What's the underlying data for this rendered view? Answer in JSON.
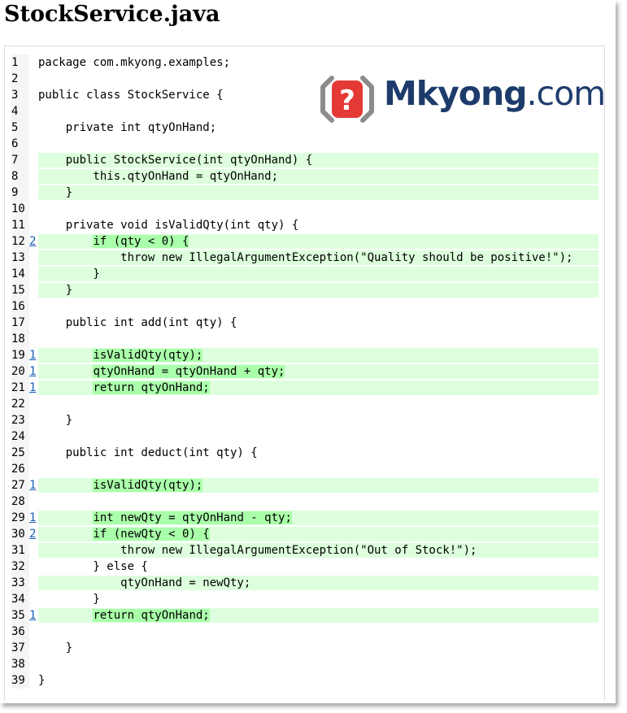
{
  "page": {
    "title": "StockService.java"
  },
  "logo": {
    "brand": "Mkyong",
    "suffix": ".com",
    "mark_glyph": "?"
  },
  "colors": {
    "covered_bg": "#ddffdd",
    "covered_highlight": "#aaffaa",
    "brand": "#1d3c6b",
    "mark_red": "#e53935"
  },
  "code": {
    "lines": [
      {
        "n": "1",
        "hits": "",
        "text": "package com.mkyong.examples;",
        "status": "none"
      },
      {
        "n": "2",
        "hits": "",
        "text": "",
        "status": "none"
      },
      {
        "n": "3",
        "hits": "",
        "text": "public class StockService {",
        "status": "none"
      },
      {
        "n": "4",
        "hits": "",
        "text": "",
        "status": "none"
      },
      {
        "n": "5",
        "hits": "",
        "text": "    private int qtyOnHand;",
        "status": "none"
      },
      {
        "n": "6",
        "hits": "",
        "text": "",
        "status": "none"
      },
      {
        "n": "7",
        "hits": "",
        "text": "    public StockService(int qtyOnHand) {",
        "status": "fc"
      },
      {
        "n": "8",
        "hits": "",
        "text": "        this.qtyOnHand = qtyOnHand;",
        "status": "fc"
      },
      {
        "n": "9",
        "hits": "",
        "text": "    }",
        "status": "fc"
      },
      {
        "n": "10",
        "hits": "",
        "text": "",
        "status": "none"
      },
      {
        "n": "11",
        "hits": "",
        "text": "    private void isValidQty(int qty) {",
        "status": "none"
      },
      {
        "n": "12",
        "hits": "2",
        "text": "        if (qty < 0) {",
        "status": "cov"
      },
      {
        "n": "13",
        "hits": "",
        "text": "            throw new IllegalArgumentException(\"Quality should be positive!\");",
        "status": "fc"
      },
      {
        "n": "14",
        "hits": "",
        "text": "        }",
        "status": "fc"
      },
      {
        "n": "15",
        "hits": "",
        "text": "    }",
        "status": "fc"
      },
      {
        "n": "16",
        "hits": "",
        "text": "",
        "status": "none"
      },
      {
        "n": "17",
        "hits": "",
        "text": "    public int add(int qty) {",
        "status": "none"
      },
      {
        "n": "18",
        "hits": "",
        "text": "",
        "status": "none"
      },
      {
        "n": "19",
        "hits": "1",
        "text": "        isValidQty(qty);",
        "status": "cov"
      },
      {
        "n": "20",
        "hits": "1",
        "text": "        qtyOnHand = qtyOnHand + qty;",
        "status": "cov"
      },
      {
        "n": "21",
        "hits": "1",
        "text": "        return qtyOnHand;",
        "status": "cov"
      },
      {
        "n": "22",
        "hits": "",
        "text": "",
        "status": "none"
      },
      {
        "n": "23",
        "hits": "",
        "text": "    }",
        "status": "none"
      },
      {
        "n": "24",
        "hits": "",
        "text": "",
        "status": "none"
      },
      {
        "n": "25",
        "hits": "",
        "text": "    public int deduct(int qty) {",
        "status": "none"
      },
      {
        "n": "26",
        "hits": "",
        "text": "",
        "status": "none"
      },
      {
        "n": "27",
        "hits": "1",
        "text": "        isValidQty(qty);",
        "status": "cov"
      },
      {
        "n": "28",
        "hits": "",
        "text": "",
        "status": "none"
      },
      {
        "n": "29",
        "hits": "1",
        "text": "        int newQty = qtyOnHand - qty;",
        "status": "cov"
      },
      {
        "n": "30",
        "hits": "2",
        "text": "        if (newQty < 0) {",
        "status": "cov"
      },
      {
        "n": "31",
        "hits": "",
        "text": "            throw new IllegalArgumentException(\"Out of Stock!\");",
        "status": "fc"
      },
      {
        "n": "32",
        "hits": "",
        "text": "        } else {",
        "status": "none"
      },
      {
        "n": "33",
        "hits": "",
        "text": "            qtyOnHand = newQty;",
        "status": "fc"
      },
      {
        "n": "34",
        "hits": "",
        "text": "        }",
        "status": "none"
      },
      {
        "n": "35",
        "hits": "1",
        "text": "        return qtyOnHand;",
        "status": "cov"
      },
      {
        "n": "36",
        "hits": "",
        "text": "",
        "status": "none"
      },
      {
        "n": "37",
        "hits": "",
        "text": "    }",
        "status": "none"
      },
      {
        "n": "38",
        "hits": "",
        "text": "",
        "status": "none"
      },
      {
        "n": "39",
        "hits": "",
        "text": "}",
        "status": "none"
      }
    ]
  }
}
